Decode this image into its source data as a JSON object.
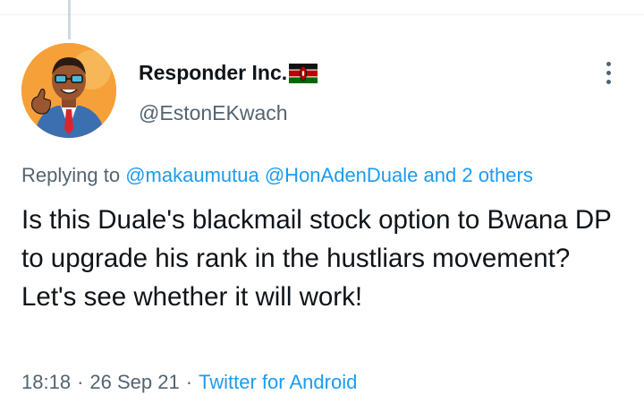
{
  "tweet": {
    "display_name": "Responder Inc.",
    "flag_icon": "kenya-flag-icon",
    "handle": "@EstonEKwach",
    "replying_prefix": "Replying to",
    "mention_1": "@makaumutua",
    "mention_2": "@HonAdenDuale",
    "mention_more": "and 2 others",
    "body": "Is this Duale's blackmail stock option to Bwana DP to upgrade his rank in the hustliars movement? Let's see whether it will work!",
    "time": "18:18",
    "separator": "·",
    "date": "26 Sep 21",
    "source": "Twitter for Android"
  },
  "colors": {
    "link": "#1d9bf0",
    "secondary_text": "#536471",
    "primary_text": "#0f1419",
    "avatar_background": "#f6a03a"
  }
}
